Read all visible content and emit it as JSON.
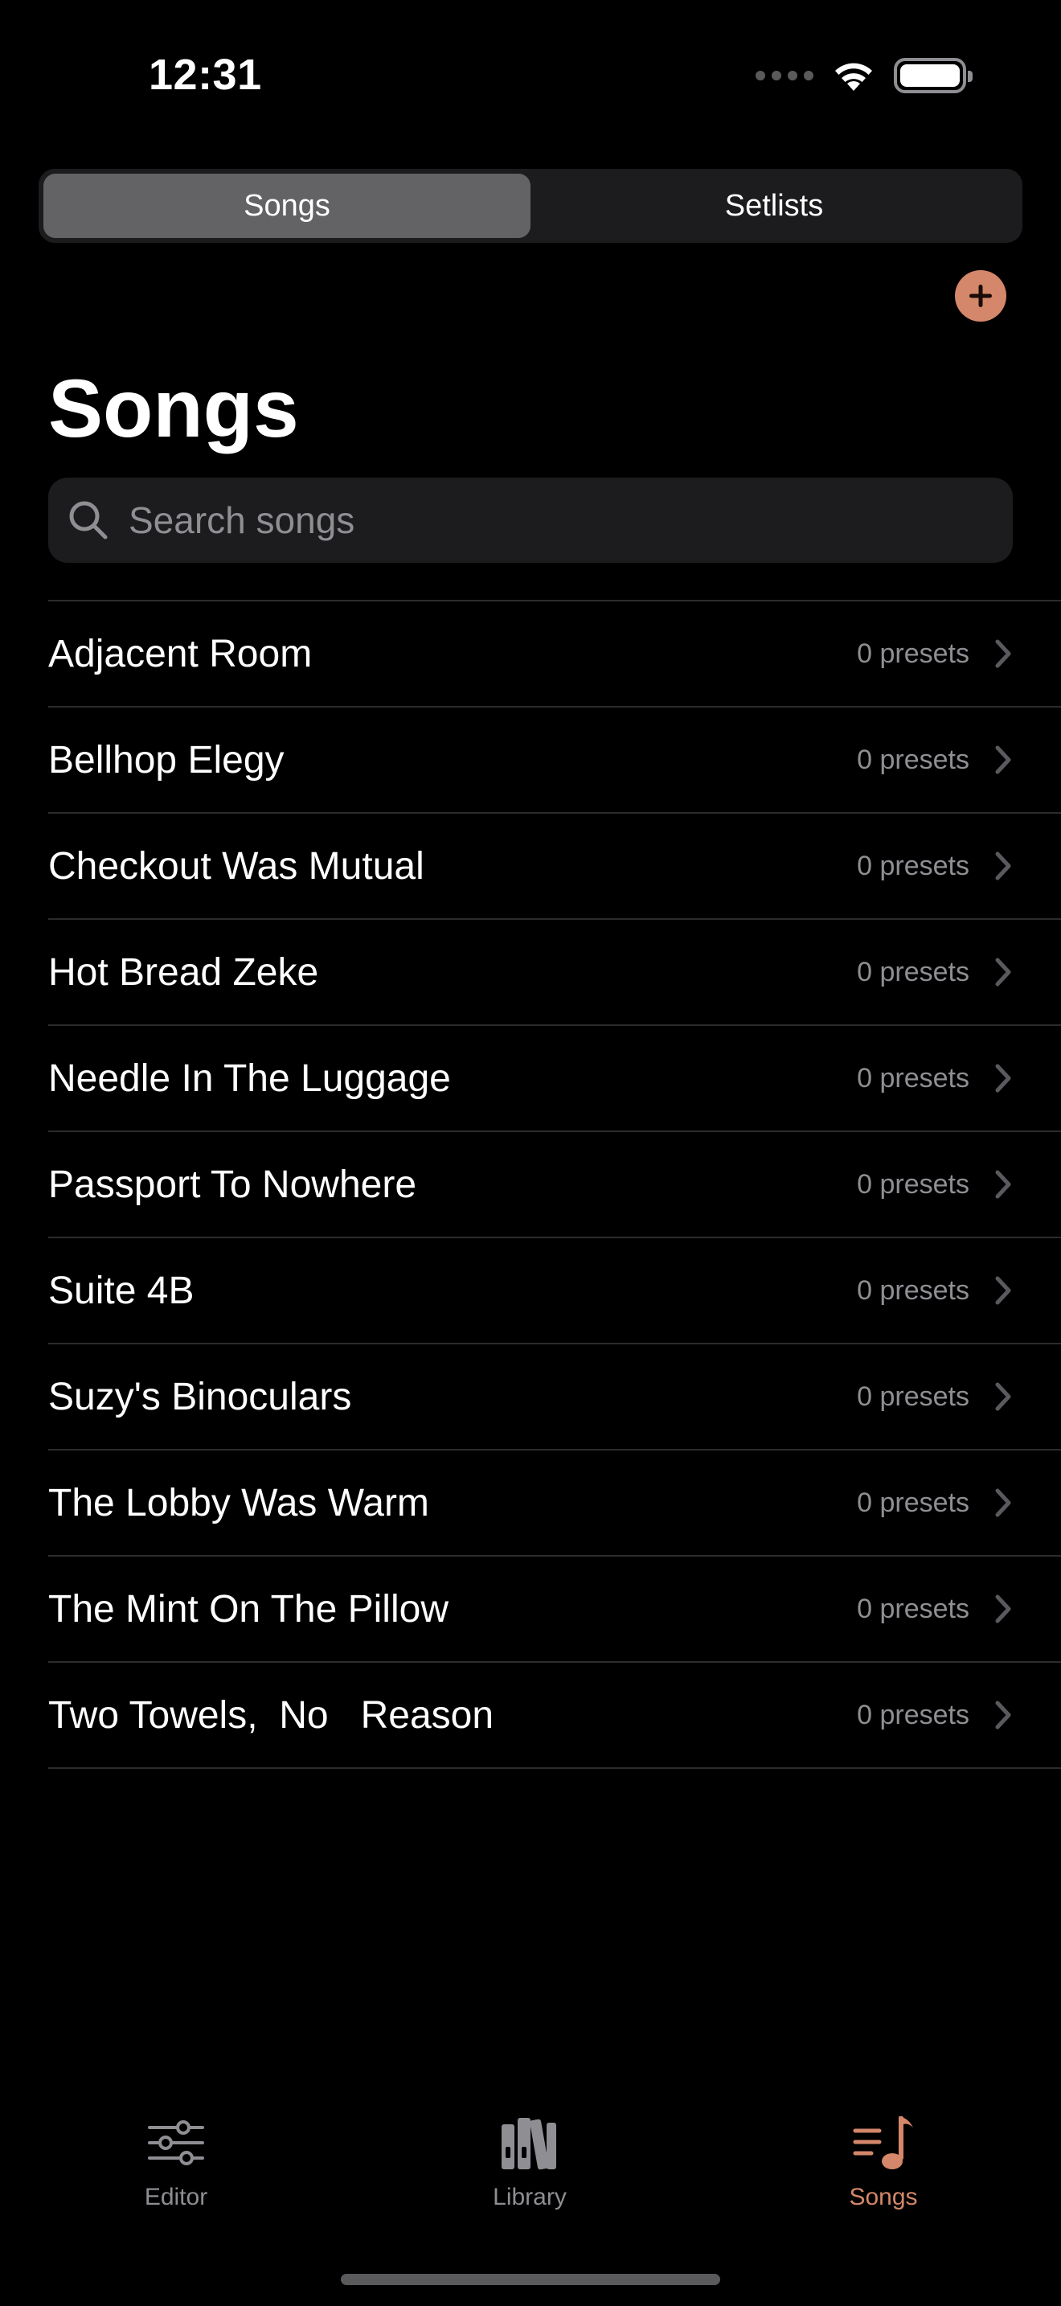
{
  "status_bar": {
    "time": "12:31"
  },
  "segmented_control": {
    "segments": [
      {
        "label": "Songs",
        "selected": true
      },
      {
        "label": "Setlists",
        "selected": false
      }
    ]
  },
  "header": {
    "title": "Songs",
    "add_icon": "plus-circle-icon"
  },
  "search": {
    "placeholder": "Search songs",
    "value": ""
  },
  "songs": [
    {
      "title": "Adjacent Room",
      "count": "0 presets"
    },
    {
      "title": "Bellhop Elegy",
      "count": "0 presets"
    },
    {
      "title": "Checkout Was Mutual",
      "count": "0 presets"
    },
    {
      "title": "Hot Bread Zeke",
      "count": "0 presets"
    },
    {
      "title": "Needle In The Luggage",
      "count": "0 presets"
    },
    {
      "title": "Passport To Nowhere",
      "count": "0 presets"
    },
    {
      "title": "Suite 4B",
      "count": "0 presets"
    },
    {
      "title": "Suzy's Binoculars",
      "count": "0 presets"
    },
    {
      "title": "The Lobby Was Warm",
      "count": "0 presets"
    },
    {
      "title": "The Mint On The Pillow",
      "count": "0 presets"
    },
    {
      "title": "Two Towels,  No   Reason",
      "count": "0 presets"
    }
  ],
  "tab_bar": {
    "tabs": [
      {
        "label": "Editor",
        "icon": "sliders-icon",
        "active": false
      },
      {
        "label": "Library",
        "icon": "books-icon",
        "active": false
      },
      {
        "label": "Songs",
        "icon": "music-note-list-icon",
        "active": true
      }
    ]
  },
  "colors": {
    "accent": "#d4876a",
    "background": "#000000",
    "secondary_text": "#8e8e93"
  }
}
